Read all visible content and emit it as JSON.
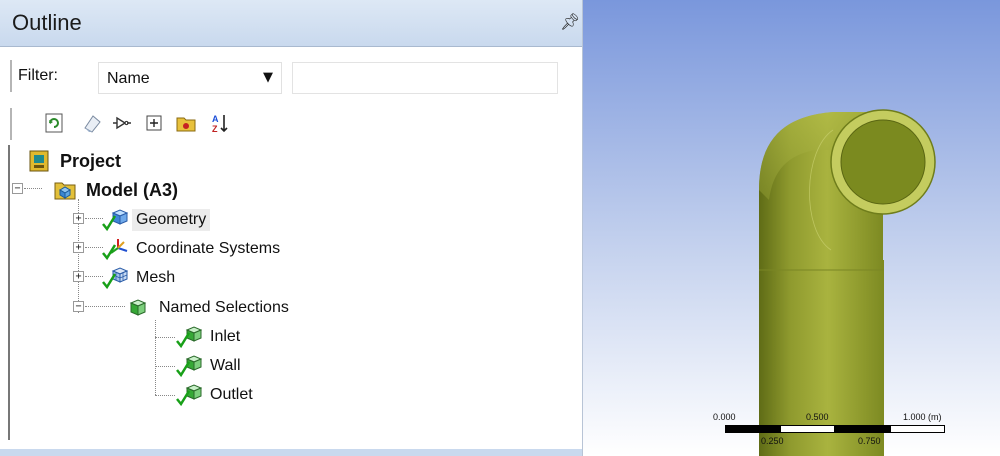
{
  "outline": {
    "title": "Outline",
    "pin_icon": "pin-icon",
    "filter": {
      "label": "Filter:",
      "selected": "Name",
      "text_value": ""
    },
    "toolbar_icons": [
      "refresh-icon",
      "clear-icon",
      "tag-icon",
      "expand-all-icon",
      "folder-icon",
      "sort-icon"
    ],
    "tree": {
      "project": "Project",
      "model": "Model (A3)",
      "geometry": "Geometry",
      "coordinate_systems": "Coordinate Systems",
      "mesh": "Mesh",
      "named_selections": "Named Selections",
      "inlet": "Inlet",
      "wall": "Wall",
      "outlet": "Outlet"
    }
  },
  "viewport": {
    "scale_labels": {
      "l0": "0.000",
      "l1": "0.500",
      "l2": "1.000 (m)",
      "l3": "0.250",
      "l4": "0.750"
    },
    "colors": {
      "pipe": "#a2ad3c",
      "pipe_dark": "#6f7d1b",
      "background_top": "#7a97dc"
    }
  }
}
